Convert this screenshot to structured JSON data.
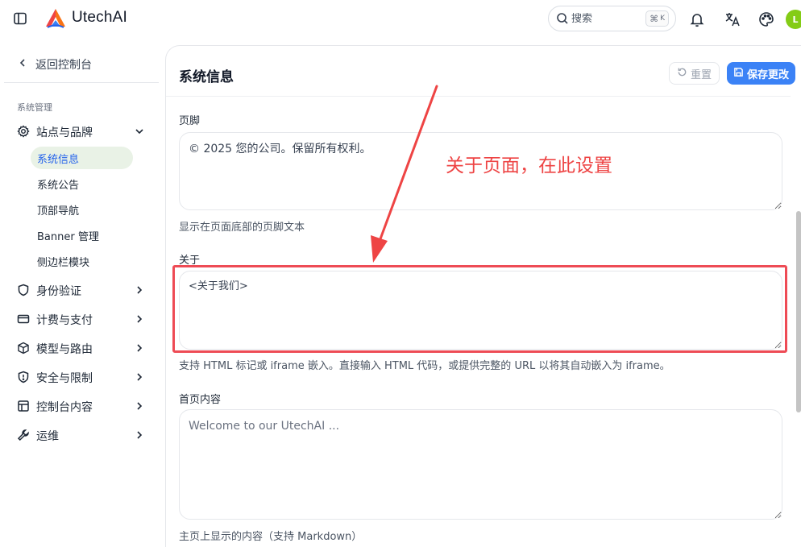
{
  "app": {
    "title": "UtechAI",
    "avatar_initial": "L"
  },
  "search": {
    "placeholder": "搜索",
    "shortcut_symbol": "⌘",
    "shortcut_key": "K"
  },
  "sidebar": {
    "back_label": "返回控制台",
    "section_label": "系统管理",
    "groups": [
      {
        "label": "站点与品牌",
        "icon": "gear-icon",
        "expanded": true,
        "items": [
          "系统信息",
          "系统公告",
          "顶部导航",
          "Banner 管理",
          "侧边栏模块"
        ],
        "active": "系统信息"
      },
      {
        "label": "身份验证",
        "icon": "shield-icon"
      },
      {
        "label": "计费与支付",
        "icon": "credit-card-icon"
      },
      {
        "label": "模型与路由",
        "icon": "cube-icon"
      },
      {
        "label": "安全与限制",
        "icon": "shield-alert-icon"
      },
      {
        "label": "控制台内容",
        "icon": "layout-icon"
      },
      {
        "label": "运维",
        "icon": "wrench-icon"
      }
    ]
  },
  "main": {
    "title": "系统信息",
    "reset_label": "重置",
    "save_label": "保存更改",
    "fields": [
      {
        "label": "页脚",
        "value": "© 2025 您的公司。保留所有权利。",
        "help": "显示在页面底部的页脚文本"
      },
      {
        "label": "关于",
        "value": "<关于我们>",
        "help": "支持 HTML 标记或 iframe 嵌入。直接输入 HTML 代码，或提供完整的 URL 以将其自动嵌入为 iframe。"
      },
      {
        "label": "首页内容",
        "placeholder": "Welcome to our UtechAI ...",
        "help": "主页上显示的内容（支持 Markdown）"
      }
    ]
  },
  "annotation": {
    "text": "关于页面，在此设置",
    "color": "#ee4444"
  },
  "colors": {
    "primary": "#3b82f6",
    "active_bg": "#e9f2e6",
    "highlight": "#ee4b55"
  }
}
